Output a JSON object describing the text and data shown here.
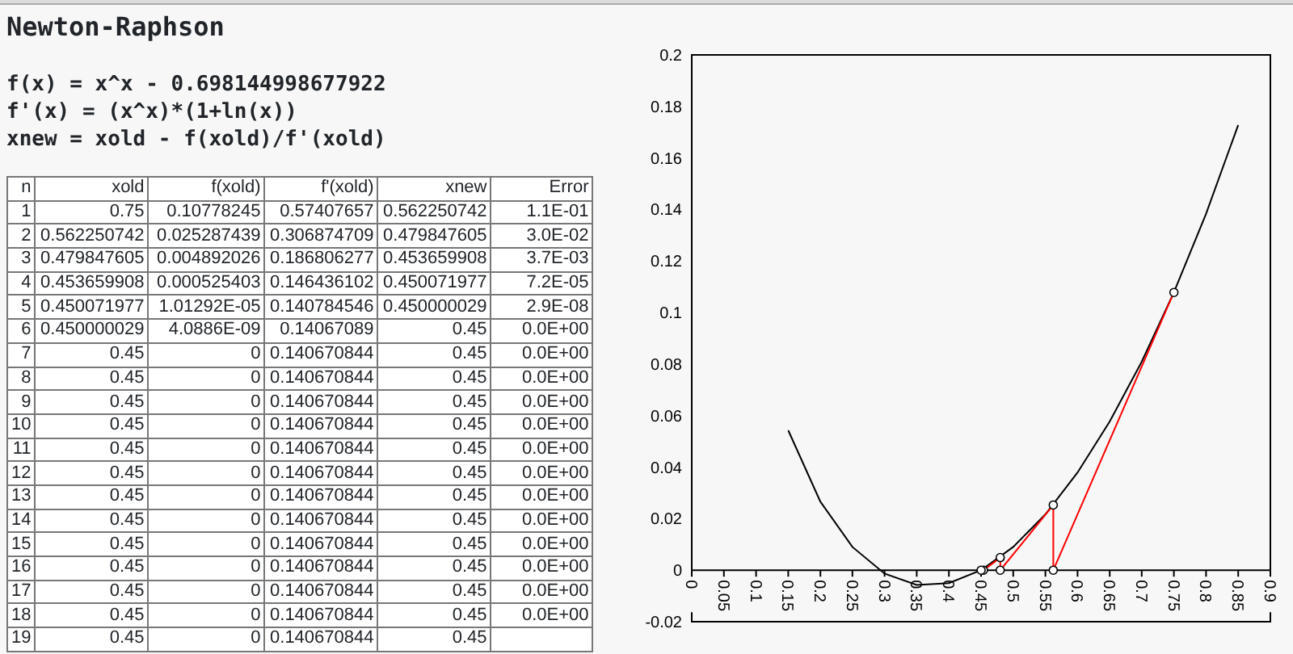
{
  "title": "Newton-Raphson",
  "formulas": [
    "f(x) = x^x - 0.698144998677922",
    "f'(x) = (x^x)*(1+ln(x))",
    "xnew = xold - f(xold)/f'(xold)"
  ],
  "table": {
    "columns": [
      "n",
      "xold",
      "f(xold)",
      "f'(xold)",
      "xnew",
      "Error"
    ],
    "rows": [
      [
        "1",
        "0.75",
        "0.10778245",
        "0.57407657",
        "0.562250742",
        "1.1E-01"
      ],
      [
        "2",
        "0.562250742",
        "0.025287439",
        "0.306874709",
        "0.479847605",
        "3.0E-02"
      ],
      [
        "3",
        "0.479847605",
        "0.004892026",
        "0.186806277",
        "0.453659908",
        "3.7E-03"
      ],
      [
        "4",
        "0.453659908",
        "0.000525403",
        "0.146436102",
        "0.450071977",
        "7.2E-05"
      ],
      [
        "5",
        "0.450071977",
        "1.01292E-05",
        "0.140784546",
        "0.450000029",
        "2.9E-08"
      ],
      [
        "6",
        "0.450000029",
        "4.0886E-09",
        "0.14067089",
        "0.45",
        "0.0E+00"
      ],
      [
        "7",
        "0.45",
        "0",
        "0.140670844",
        "0.45",
        "0.0E+00"
      ],
      [
        "8",
        "0.45",
        "0",
        "0.140670844",
        "0.45",
        "0.0E+00"
      ],
      [
        "9",
        "0.45",
        "0",
        "0.140670844",
        "0.45",
        "0.0E+00"
      ],
      [
        "10",
        "0.45",
        "0",
        "0.140670844",
        "0.45",
        "0.0E+00"
      ],
      [
        "11",
        "0.45",
        "0",
        "0.140670844",
        "0.45",
        "0.0E+00"
      ],
      [
        "12",
        "0.45",
        "0",
        "0.140670844",
        "0.45",
        "0.0E+00"
      ],
      [
        "13",
        "0.45",
        "0",
        "0.140670844",
        "0.45",
        "0.0E+00"
      ],
      [
        "14",
        "0.45",
        "0",
        "0.140670844",
        "0.45",
        "0.0E+00"
      ],
      [
        "15",
        "0.45",
        "0",
        "0.140670844",
        "0.45",
        "0.0E+00"
      ],
      [
        "16",
        "0.45",
        "0",
        "0.140670844",
        "0.45",
        "0.0E+00"
      ],
      [
        "17",
        "0.45",
        "0",
        "0.140670844",
        "0.45",
        "0.0E+00"
      ],
      [
        "18",
        "0.45",
        "0",
        "0.140670844",
        "0.45",
        "0.0E+00"
      ],
      [
        "19",
        "0.45",
        "0",
        "0.140670844",
        "0.45"
      ]
    ]
  },
  "chart": {
    "chart_data": {
      "type": "line",
      "xlim": [
        0,
        0.9
      ],
      "ylim": [
        -0.02,
        0.2
      ],
      "xticks": [
        0,
        0.05,
        0.1,
        0.15,
        0.2,
        0.25,
        0.3,
        0.35,
        0.4,
        0.45,
        0.5,
        0.55,
        0.6,
        0.65,
        0.7,
        0.75,
        0.8,
        0.85,
        0.9
      ],
      "yticks": [
        -0.02,
        0,
        0.02,
        0.04,
        0.06,
        0.08,
        0.1,
        0.12,
        0.14,
        0.16,
        0.18,
        0.2
      ],
      "series": [
        {
          "color": "#000000",
          "x": [
            0.15,
            0.2,
            0.25,
            0.3,
            0.35,
            0.4,
            0.45,
            0.5,
            0.55,
            0.6,
            0.65,
            0.7,
            0.75,
            0.8,
            0.85
          ],
          "values": [
            0.0543,
            0.0266,
            0.009,
            -0.0013,
            -0.0057,
            -0.005,
            0,
            0.009,
            0.0217,
            0.0379,
            0.0577,
            0.0809,
            0.1078,
            0.1383,
            0.1728
          ]
        },
        {
          "color": "#ff0000",
          "x": [
            0.75,
            0.5623,
            0.5623,
            0.4798,
            0.4798,
            0.4537,
            0.4501
          ],
          "values": [
            0.1078,
            0,
            0.0253,
            0,
            0.0049,
            0,
            0
          ]
        }
      ]
    }
  }
}
